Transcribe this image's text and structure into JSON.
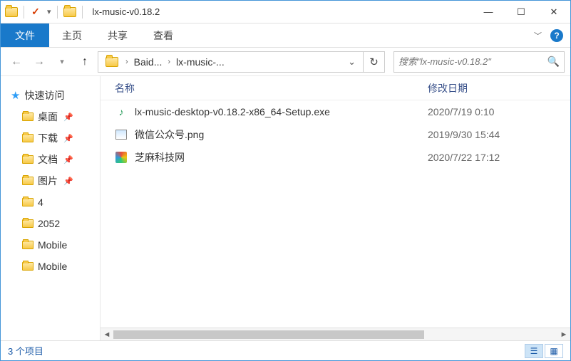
{
  "title": "lx-music-v0.18.2",
  "tabs": {
    "file": "文件",
    "home": "主页",
    "share": "共享",
    "view": "查看"
  },
  "breadcrumb": [
    "Baid...",
    "lx-music-..."
  ],
  "search_placeholder": "搜索\"lx-music-v0.18.2\"",
  "sidebar": {
    "quick_access": "快速访问",
    "items": [
      "桌面",
      "下载",
      "文档",
      "图片",
      "4",
      "2052",
      "Mobile",
      "Mobile"
    ]
  },
  "columns": {
    "name": "名称",
    "date": "修改日期"
  },
  "files": [
    {
      "icon": "exe",
      "name": "lx-music-desktop-v0.18.2-x86_64-Setup.exe",
      "date": "2020/7/19 0:10"
    },
    {
      "icon": "png",
      "name": "微信公众号.png",
      "date": "2019/9/30 15:44"
    },
    {
      "icon": "link",
      "name": "芝麻科技网",
      "date": "2020/7/22 17:12"
    }
  ],
  "status": "3 个项目"
}
